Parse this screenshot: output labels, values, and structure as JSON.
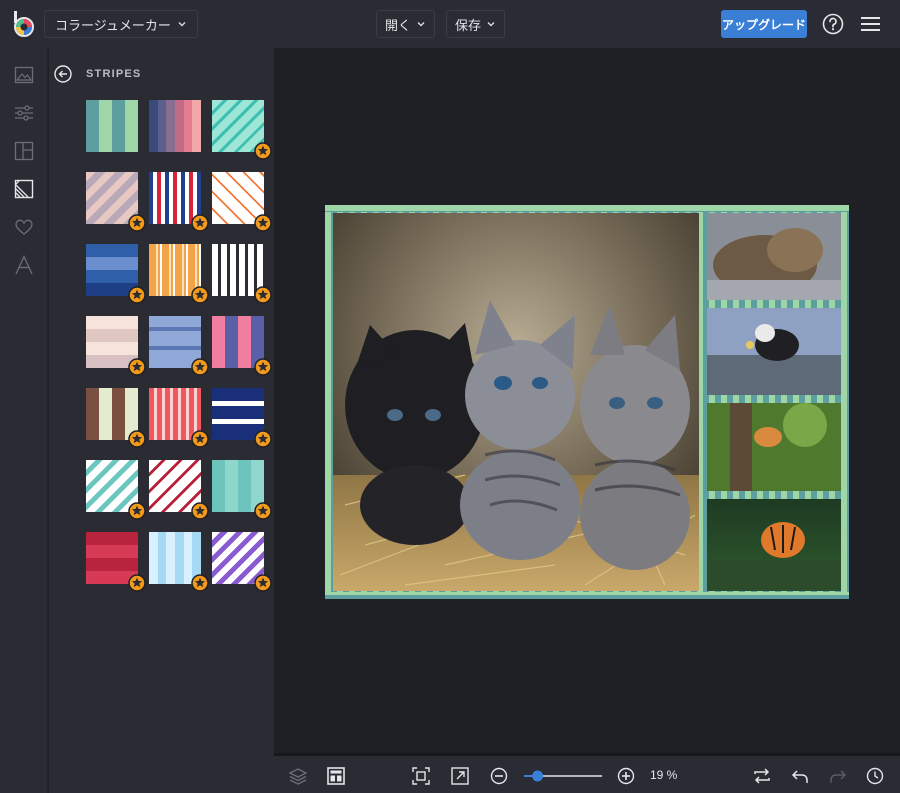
{
  "header": {
    "app_menu_label": "コラージュメーカー",
    "open_label": "開く",
    "save_label": "保存",
    "upgrade_label": "アップグレード"
  },
  "rail": {
    "items": [
      "image-icon",
      "adjust-sliders-icon",
      "layout-icon",
      "background-icon",
      "heart-icon",
      "text-icon"
    ],
    "active": "background-icon"
  },
  "panel": {
    "title": "STRIPES",
    "patterns": [
      {
        "premium": false
      },
      {
        "premium": false
      },
      {
        "premium": true
      },
      {
        "premium": true
      },
      {
        "premium": true
      },
      {
        "premium": true
      },
      {
        "premium": true
      },
      {
        "premium": true
      },
      {
        "premium": true
      },
      {
        "premium": true
      },
      {
        "premium": true
      },
      {
        "premium": true
      },
      {
        "premium": true
      },
      {
        "premium": true
      },
      {
        "premium": true
      },
      {
        "premium": true
      },
      {
        "premium": true
      },
      {
        "premium": true
      },
      {
        "premium": true
      },
      {
        "premium": true
      },
      {
        "premium": true
      }
    ]
  },
  "collage": {
    "photos": [
      "kittens-photo",
      "sleeping-kitten-photo",
      "kitten-on-path-photo",
      "kitten-in-tree-photo",
      "tiger-in-water-photo"
    ]
  },
  "zoom": {
    "percent_label": "19 %",
    "value": 19
  },
  "colors": {
    "accent": "#3a7fd6",
    "premium_star": "#f39a1b",
    "stripe_green": "#9fd6a8",
    "stripe_teal": "#5d9f9f"
  }
}
